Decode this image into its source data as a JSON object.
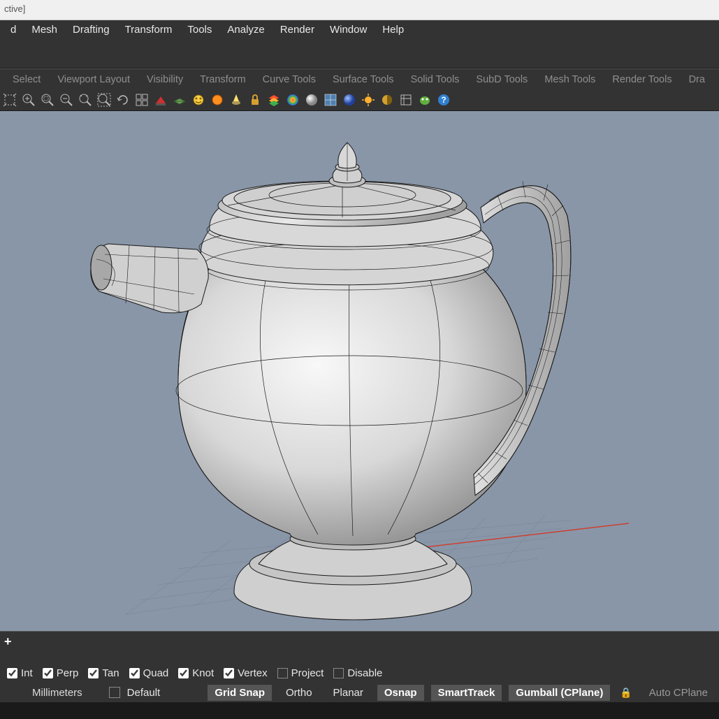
{
  "title": "ctive]",
  "menu": [
    "d",
    "Mesh",
    "Drafting",
    "Transform",
    "Tools",
    "Analyze",
    "Render",
    "Window",
    "Help"
  ],
  "tabs": [
    "Select",
    "Viewport Layout",
    "Visibility",
    "Transform",
    "Curve Tools",
    "Surface Tools",
    "Solid Tools",
    "SubD Tools",
    "Mesh Tools",
    "Render Tools",
    "Dra"
  ],
  "osnap": {
    "int": {
      "label": "Int",
      "checked": true
    },
    "perp": {
      "label": "Perp",
      "checked": true
    },
    "tan": {
      "label": "Tan",
      "checked": true
    },
    "quad": {
      "label": "Quad",
      "checked": true
    },
    "knot": {
      "label": "Knot",
      "checked": true
    },
    "vertex": {
      "label": "Vertex",
      "checked": true
    },
    "project": {
      "label": "Project",
      "checked": false
    },
    "disable": {
      "label": "Disable",
      "checked": false
    }
  },
  "status": {
    "units": "Millimeters",
    "layer": "Default",
    "gridsnap": "Grid Snap",
    "ortho": "Ortho",
    "planar": "Planar",
    "osnap": "Osnap",
    "smarttrack": "SmartTrack",
    "gumball": "Gumball (CPlane)",
    "autocplane": "Auto CPlane"
  },
  "viewport_tabs": {
    "plus": "+"
  },
  "colors": {
    "viewport_bg": "#8996a8",
    "ui_bg": "#333333",
    "active_bg": "#555555"
  }
}
